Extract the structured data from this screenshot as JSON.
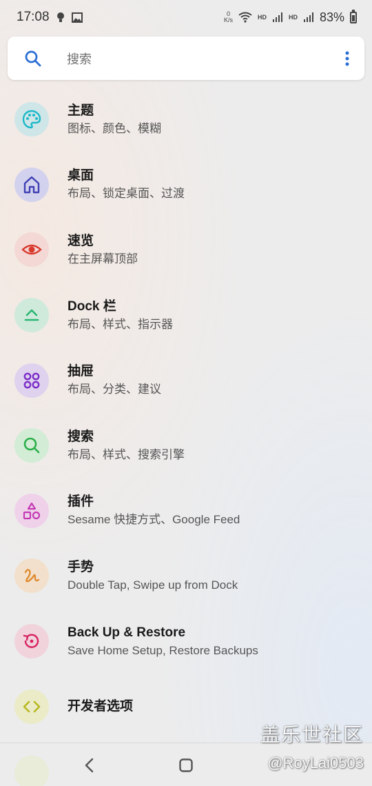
{
  "status_bar": {
    "time": "17:08",
    "net_speed_value": "0",
    "net_speed_unit": "K/s",
    "hd1": "HD",
    "hd2": "HD",
    "battery": "83%"
  },
  "search": {
    "placeholder": "搜索"
  },
  "items": [
    {
      "title": "主题",
      "subtitle": "图标、颜色、模糊",
      "icon": "palette-icon",
      "color": "#1cb9c8",
      "bg": "#cfe6e9"
    },
    {
      "title": "桌面",
      "subtitle": "布局、锁定桌面、过渡",
      "icon": "home-icon",
      "color": "#3f3fb5",
      "bg": "#d3d2ee"
    },
    {
      "title": "速览",
      "subtitle": "在主屏幕顶部",
      "icon": "eye-icon",
      "color": "#d93a2e",
      "bg": "#f3d8d5"
    },
    {
      "title": "Dock 栏",
      "subtitle": "布局、样式、指示器",
      "icon": "dock-icon",
      "color": "#2bb673",
      "bg": "#cfeadb"
    },
    {
      "title": "抽屉",
      "subtitle": "布局、分类、建议",
      "icon": "apps-grid-icon",
      "color": "#7b2cc8",
      "bg": "#dfd2ee"
    },
    {
      "title": "搜索",
      "subtitle": "布局、样式、搜索引擎",
      "icon": "search-icon",
      "color": "#2caf4a",
      "bg": "#d2ecd5"
    },
    {
      "title": "插件",
      "subtitle": "Sesame 快捷方式、Google Feed",
      "icon": "shapes-icon",
      "color": "#c43ab4",
      "bg": "#efd2ea"
    },
    {
      "title": "手势",
      "subtitle": "Double Tap, Swipe up from Dock",
      "icon": "gesture-icon",
      "color": "#e08a2e",
      "bg": "#f2e0cc"
    },
    {
      "title": "Back Up & Restore",
      "subtitle": "Save Home Setup, Restore Backups",
      "icon": "backup-restore-icon",
      "color": "#d6225f",
      "bg": "#f1d3dc"
    },
    {
      "title": "开发者选项",
      "subtitle": "",
      "icon": "code-icon",
      "color": "#b8b81f",
      "bg": "#ebebc8"
    }
  ],
  "watermark": {
    "line1": "盖乐世社区",
    "line2": "@RoyLai0503"
  }
}
